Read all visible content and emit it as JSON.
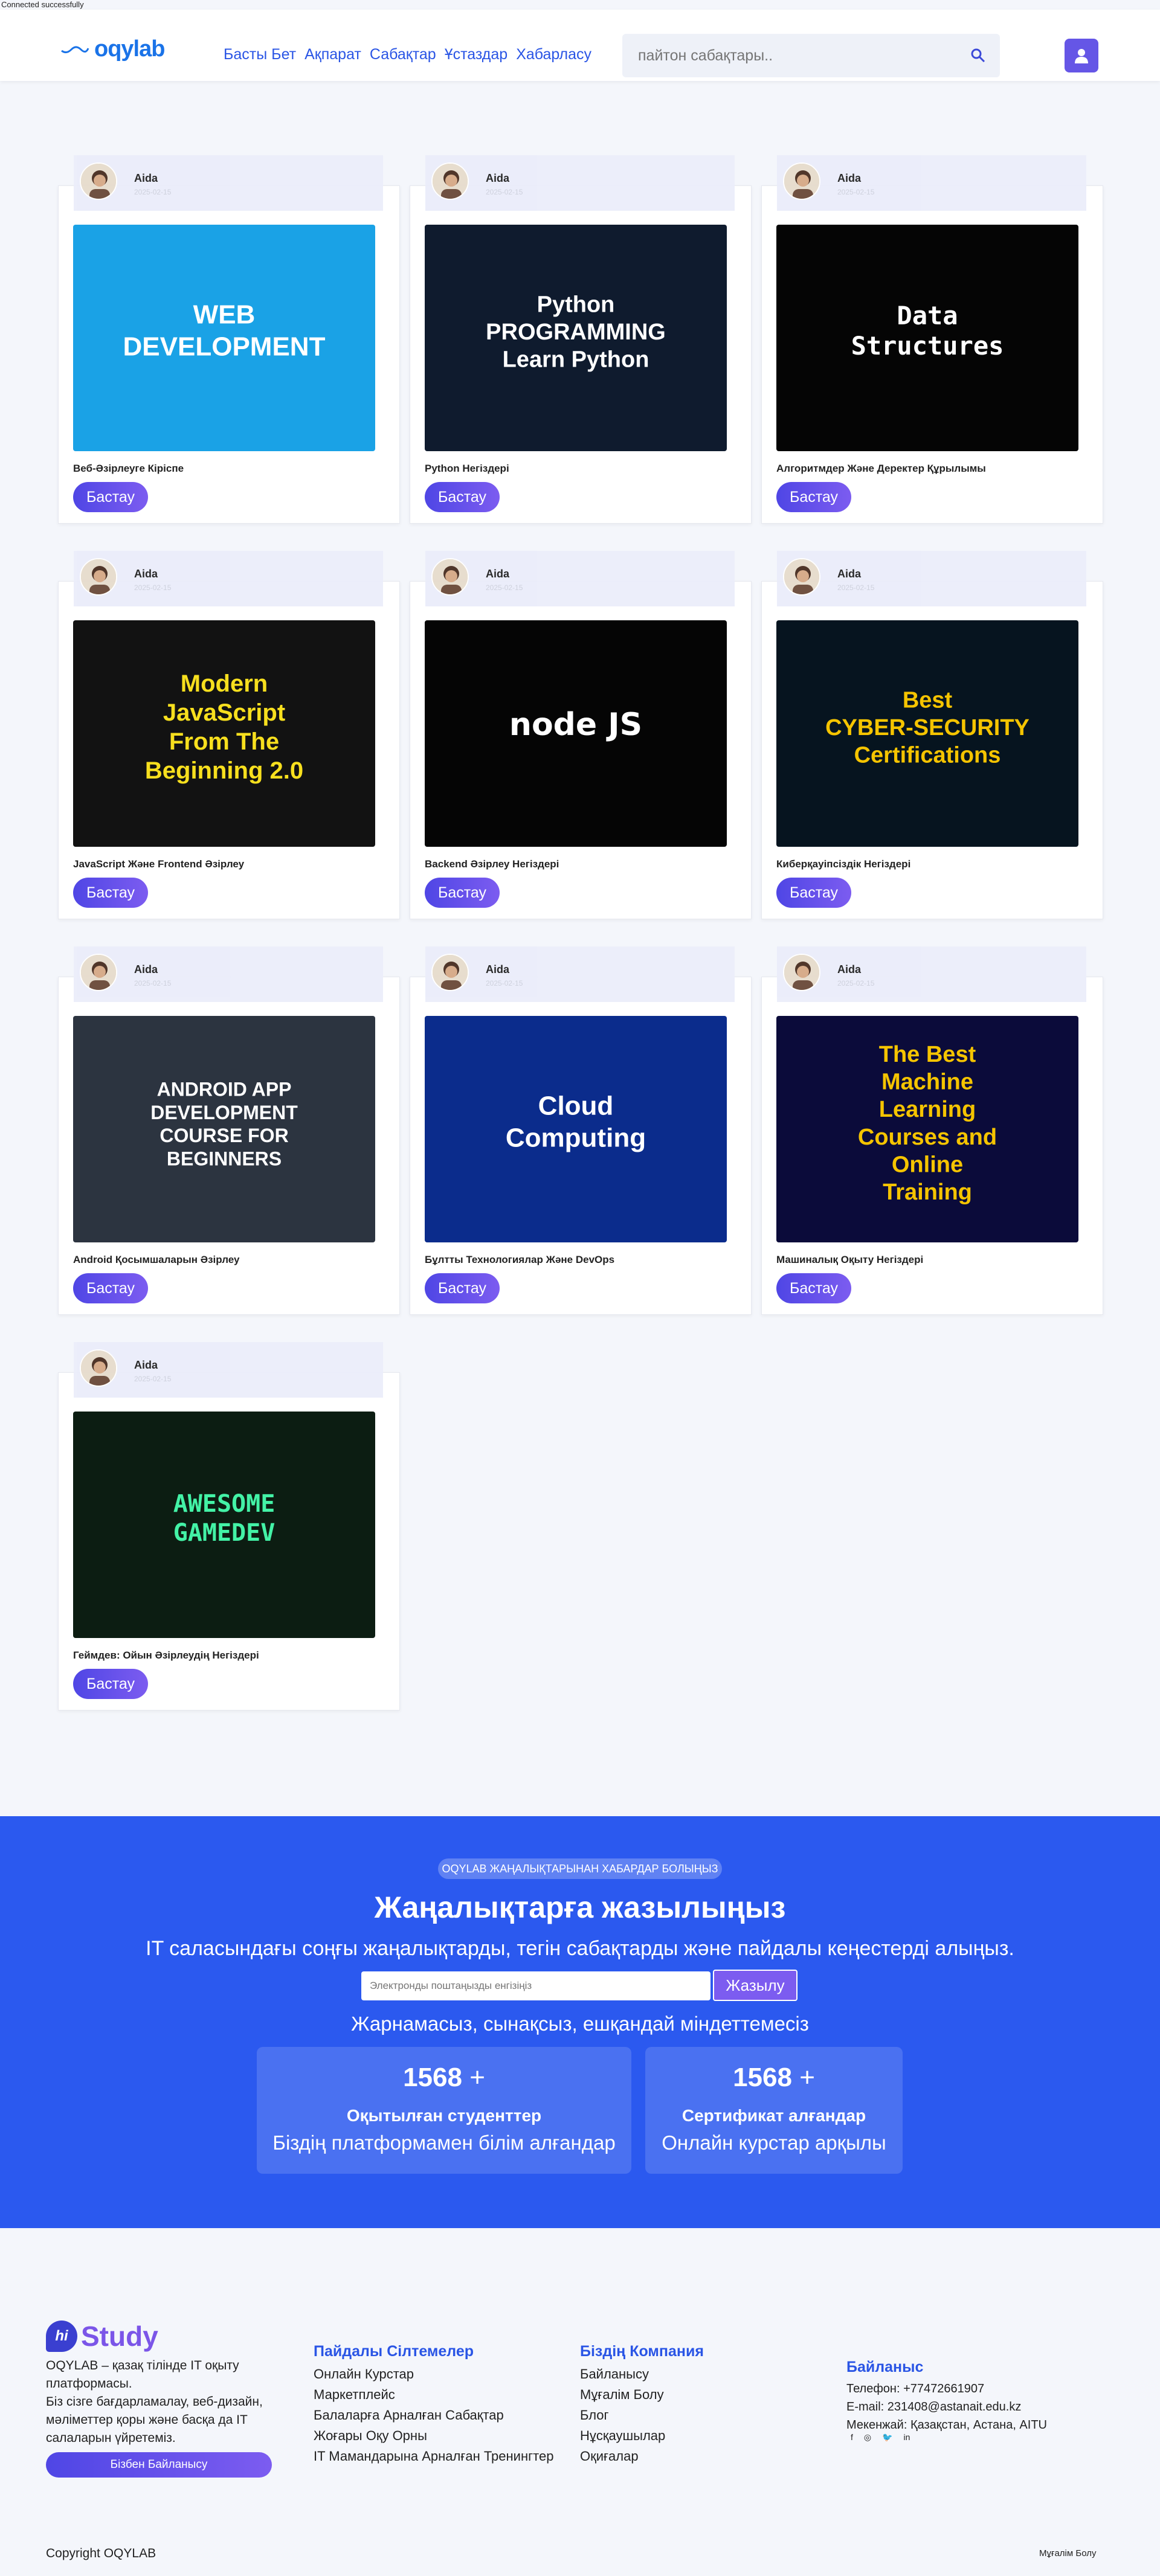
{
  "status": "Connected successfully",
  "header": {
    "logo": "oqylab",
    "nav": [
      "Басты Бет",
      "Ақпарат",
      "Сабақтар",
      "Ұстаздар",
      "Хабарласу"
    ],
    "search_placeholder": "пайтон сабақтары.."
  },
  "courses": [
    {
      "author": "Aida",
      "date": "2025-02-15",
      "title": "Веб-Әзірлеуге Кіріспе",
      "button": "Бастау",
      "image": "WEB DEVELOPMENT"
    },
    {
      "author": "Aida",
      "date": "2025-02-15",
      "title": "Python Негіздері",
      "button": "Бастау",
      "image": "Python PROGRAMMING Learn Python"
    },
    {
      "author": "Aida",
      "date": "2025-02-15",
      "title": "Алгоритмдер Және Деректер Құрылымы",
      "button": "Бастау",
      "image": "Data Structures"
    },
    {
      "author": "Aida",
      "date": "2025-02-15",
      "title": "JavaScript Және Frontend Әзірлеу",
      "button": "Бастау",
      "image": "Modern JavaScript From The Beginning 2.0"
    },
    {
      "author": "Aida",
      "date": "2025-02-15",
      "title": "Backend Әзірлеу Негіздері",
      "button": "Бастау",
      "image": "node JS"
    },
    {
      "author": "Aida",
      "date": "2025-02-15",
      "title": "Киберқауіпсіздік Негіздері",
      "button": "Бастау",
      "image": "Best CYBER-SECURITY Certifications"
    },
    {
      "author": "Aida",
      "date": "2025-02-15",
      "title": "Android Қосымшаларын Әзірлеу",
      "button": "Бастау",
      "image": "ANDROID APP DEVELOPMENT COURSE FOR BEGINNERS"
    },
    {
      "author": "Aida",
      "date": "2025-02-15",
      "title": "Бұлтты Технологиялар Және DevOps",
      "button": "Бастау",
      "image": "Cloud Computing"
    },
    {
      "author": "Aida",
      "date": "2025-02-15",
      "title": "Машиналық Оқыту Негіздері",
      "button": "Бастау",
      "image": "The Best Machine Learning Courses and Online Training"
    },
    {
      "author": "Aida",
      "date": "2025-02-15",
      "title": "Геймдев: Ойын Әзірлеудің Негіздері",
      "button": "Бастау",
      "image": "AWESOME GAMEDEV"
    }
  ],
  "newsletter": {
    "badge": "OQYLAB ЖАҢАЛЫҚТАРЫНАН ХАБАРДАР БОЛЫҢЫЗ",
    "title": "Жаңалықтарға жазылыңыз",
    "subtitle": "IT саласындағы соңғы жаңалықтарды, тегін сабақтарды және пайдалы кеңестерді алыңыз.",
    "email_placeholder": "Электронды поштаңызды енгізіңіз",
    "button": "Жазылу",
    "note": "Жарнамасыз, сынақсыз, ешқандай міндеттемесіз",
    "stats": [
      {
        "number": "1568",
        "plus": "+",
        "label": "Оқытылған студенттер",
        "desc": "Біздің платформамен білім алғандар"
      },
      {
        "number": "1568",
        "plus": "+",
        "label": "Сертификат алғандар",
        "desc": "Онлайн курстар арқылы"
      }
    ]
  },
  "footer": {
    "logo_mark": "hi",
    "logo_text": "Study",
    "description": "OQYLAB – қазақ тілінде IT оқыту платформасы.\nБіз сізге бағдарламалау, веб-дизайн, мәліметтер қоры және басқа да IT салаларын үйретеміз.",
    "contact_button": "Бізбен Байланысу",
    "useful_links": {
      "title": "Пайдалы Сілтемелер",
      "items": [
        "Онлайн Курстар",
        "Маркетплейс",
        "Балаларға Арналған Сабақтар",
        "Жоғары Оқу Орны",
        "IT Мамандарына Арналған Тренингтер"
      ]
    },
    "company": {
      "title": "Біздің Компания",
      "items": [
        "Байланысу",
        "Мұғалім Болу",
        "Блог",
        "Нұсқаушылар",
        "Оқиғалар"
      ]
    },
    "contact": {
      "title": "Байланыс",
      "phone": "Телефон: +77472661907",
      "email": "E-mail: 231408@astanait.edu.kz",
      "address": "Мекенжай: Қазақстан, Астана, AITU"
    },
    "socials": [
      "f",
      "◎",
      "🐦",
      "in"
    ],
    "copyright": "Copyright OQYLAB",
    "teacher_link": "Мұғалім Болу"
  }
}
